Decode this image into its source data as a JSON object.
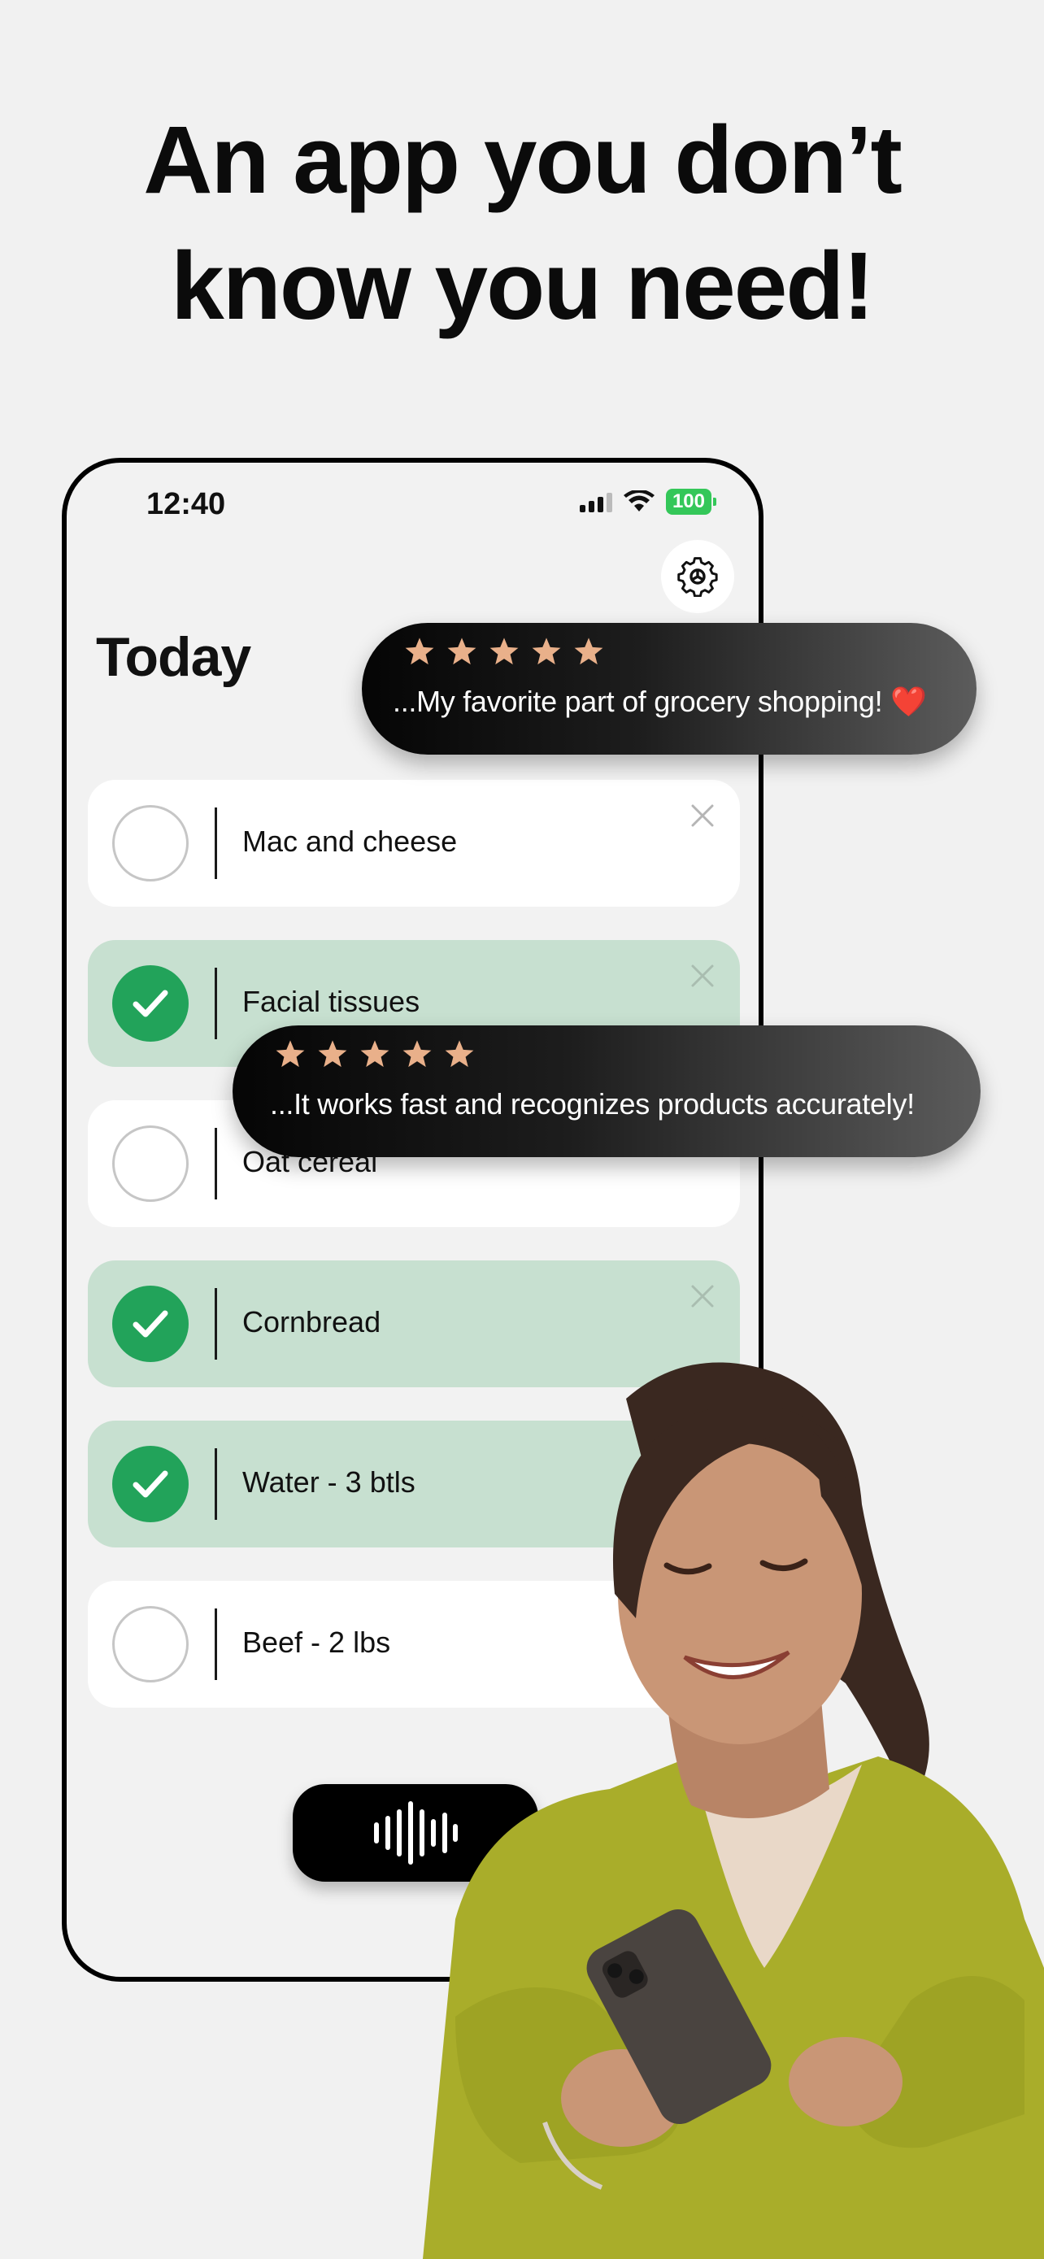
{
  "headline": {
    "line1": "An app you don’t",
    "line2": "know you need!"
  },
  "status_bar": {
    "time": "12:40",
    "battery": "100"
  },
  "screen": {
    "title": "Today",
    "items": [
      {
        "label": "Mac and cheese",
        "checked": false
      },
      {
        "label": "Facial tissues",
        "checked": true
      },
      {
        "label": "Oat cereal",
        "checked": false
      },
      {
        "label": "Cornbread",
        "checked": true
      },
      {
        "label": "Water - 3 btls",
        "checked": true
      },
      {
        "label": "Beef - 2 lbs",
        "checked": false
      }
    ]
  },
  "reviews": [
    {
      "rating": 5,
      "text": "...My favorite part of grocery shopping!",
      "emoji": "❤️"
    },
    {
      "rating": 5,
      "text": "...It works fast and recognizes products accurately!"
    }
  ],
  "colors": {
    "accent_green": "#22a35a",
    "checked_row": "#c7e0d0",
    "star": "#e9b08a",
    "battery": "#34c759"
  },
  "icons": {
    "settings": "gear-icon",
    "record": "waveform-icon",
    "remove": "close-icon",
    "checked": "checkmark-icon"
  }
}
